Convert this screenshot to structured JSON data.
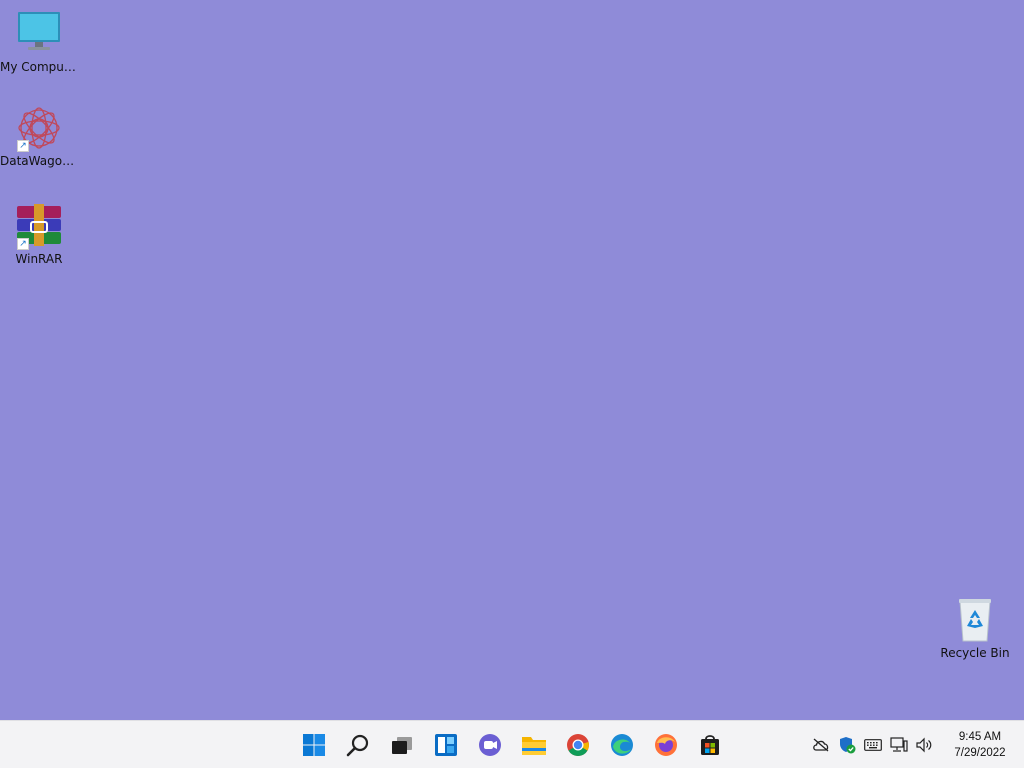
{
  "desktop": {
    "background": "#8f8bd8",
    "icons": [
      {
        "label": "My Computer",
        "icon": "monitor-icon"
      },
      {
        "label": "DataWagon...",
        "icon": "datawagon-logo-icon",
        "shortcut": true
      },
      {
        "label": "WinRAR",
        "icon": "winrar-icon",
        "shortcut": true
      },
      {
        "label": "Recycle Bin",
        "icon": "recycle-bin-icon"
      }
    ]
  },
  "taskbar": {
    "pinned": [
      {
        "name": "start",
        "icon": "windows-start-icon"
      },
      {
        "name": "search",
        "icon": "search-icon"
      },
      {
        "name": "task-view",
        "icon": "task-view-icon"
      },
      {
        "name": "widgets",
        "icon": "widgets-icon"
      },
      {
        "name": "teams-chat",
        "icon": "chat-icon"
      },
      {
        "name": "file-explorer",
        "icon": "folder-icon"
      },
      {
        "name": "chrome",
        "icon": "chrome-icon"
      },
      {
        "name": "edge",
        "icon": "edge-icon"
      },
      {
        "name": "firefox",
        "icon": "firefox-icon"
      },
      {
        "name": "store",
        "icon": "store-icon"
      }
    ],
    "tray": {
      "icons": [
        "onedrive-offline-icon",
        "defender-icon",
        "keyboard-icon",
        "network-icon",
        "volume-icon"
      ],
      "time": "9:45 AM",
      "date": "7/29/2022"
    }
  }
}
